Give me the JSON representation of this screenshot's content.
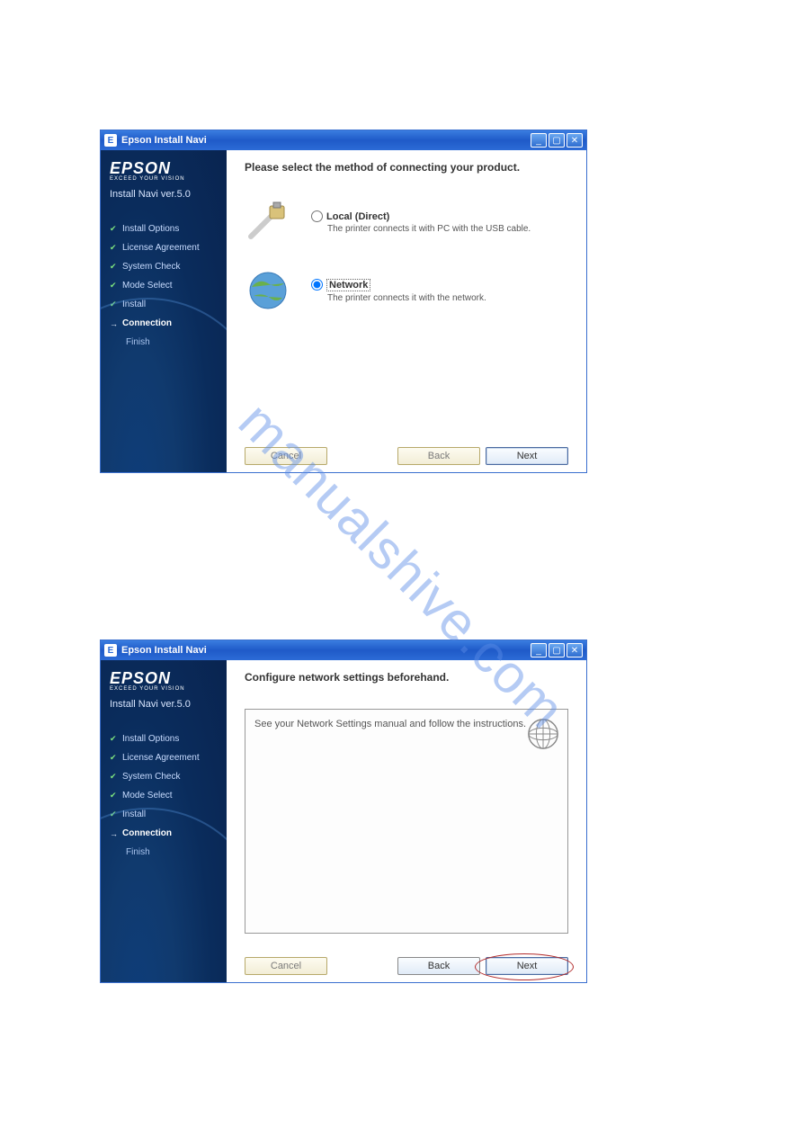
{
  "watermark": "manualshive.com",
  "window": {
    "title": "Epson Install Navi"
  },
  "sidebar": {
    "brand": "EPSON",
    "tagline": "EXCEED YOUR VISION",
    "version": "Install Navi ver.5.0",
    "steps": {
      "install_options": "Install Options",
      "license_agreement": "License Agreement",
      "system_check": "System Check",
      "mode_select": "Mode Select",
      "install": "Install",
      "connection": "Connection",
      "finish": "Finish"
    }
  },
  "screen1": {
    "heading": "Please select the method of connecting your product.",
    "option_local": {
      "label": "Local (Direct)",
      "desc": "The printer connects it with PC with the USB cable."
    },
    "option_network": {
      "label": "Network",
      "desc": "The printer connects it with the network."
    }
  },
  "screen2": {
    "heading": "Configure network settings beforehand.",
    "instruction": "See your Network Settings manual and follow the instructions."
  },
  "buttons": {
    "cancel": "Cancel",
    "back": "Back",
    "next": "Next"
  }
}
